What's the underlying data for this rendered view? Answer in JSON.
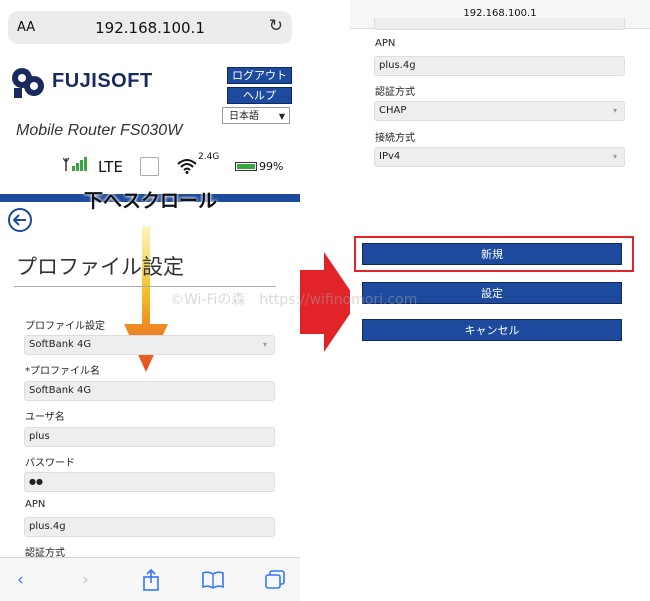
{
  "left": {
    "url": "192.168.100.1",
    "aa": "AA",
    "brand": "FUJISOFT",
    "logout": "ログアウト",
    "help": "ヘルプ",
    "language": "日本語",
    "model": "Mobile Router FS030W",
    "status": {
      "network": "LTE",
      "band": "2.4G",
      "battery": "99%"
    },
    "scroll_hint": "下へスクロール",
    "page_title": "プロファイル設定",
    "form": {
      "profile_setting_label": "プロファイル設定",
      "profile_setting_value": "SoftBank 4G",
      "profile_name_label": "*プロファイル名",
      "profile_name_value": "SoftBank 4G",
      "user_label": "ユーザ名",
      "user_value": "plus",
      "password_label": "パスワード",
      "password_value": "●●",
      "apn_label": "APN",
      "apn_value": "plus.4g",
      "auth_label": "認証方式"
    }
  },
  "right": {
    "url": "192.168.100.1",
    "apn_label": "APN",
    "apn_value": "plus.4g",
    "auth_label": "認証方式",
    "auth_value": "CHAP",
    "conn_label": "接続方式",
    "conn_value": "IPv4",
    "new_button": "新規",
    "set_button": "設定",
    "cancel_button": "キャンセル"
  },
  "watermark": "©Wi-Fiの森　https://wifinomori.com",
  "colors": {
    "accent": "#1d4a9c",
    "highlight": "#e0242a",
    "ios_blue": "#3478f6"
  }
}
